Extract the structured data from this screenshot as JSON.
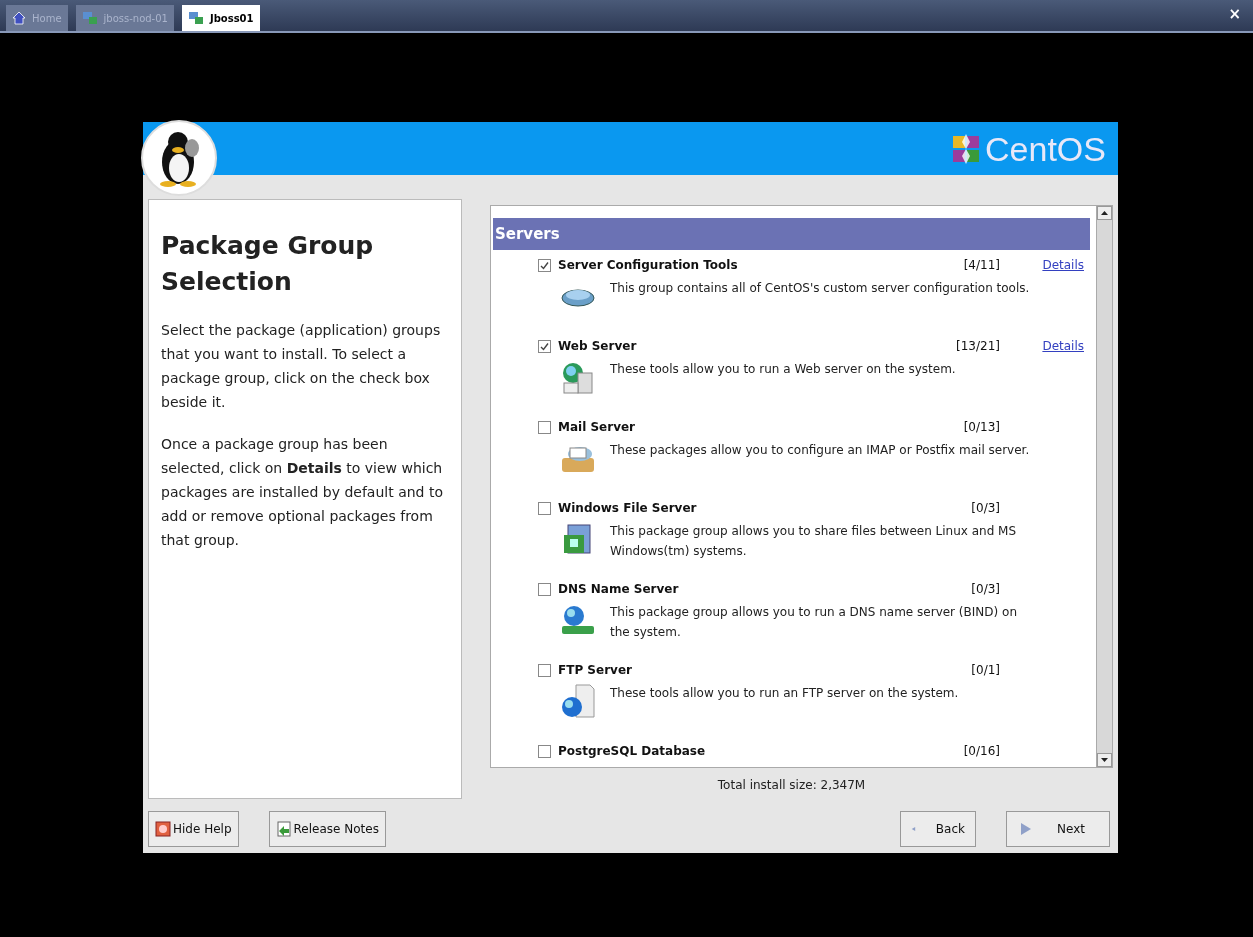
{
  "tabs": [
    {
      "label": "Home",
      "selected": false
    },
    {
      "label": "jboss-nod-01",
      "selected": false
    },
    {
      "label": "Jboss01",
      "selected": true
    }
  ],
  "close_glyph": "×",
  "header": {
    "brand": "CentOS"
  },
  "help": {
    "title": "Package Group Selection",
    "paragraphs": [
      "Select the package (application) groups that you want to install. To select a package group, click on the check box beside it.",
      "Once a package group has been selected, click on **Details** to view which packages are installed by default and to add or remove optional packages from that group."
    ]
  },
  "category": "Servers",
  "groups": [
    {
      "name": "Server Configuration Tools",
      "checked": true,
      "count": "[4/11]",
      "details": "Details",
      "description": "This group contains all of CentOS's custom server configuration tools."
    },
    {
      "name": "Web Server",
      "checked": true,
      "count": "[13/21]",
      "details": "Details",
      "description": "These tools allow you to run a Web server on the system."
    },
    {
      "name": "Mail Server",
      "checked": false,
      "count": "[0/13]",
      "description": "These packages allow you to configure an IMAP or Postfix mail server."
    },
    {
      "name": "Windows File Server",
      "checked": false,
      "count": "[0/3]",
      "description": "This package group allows you to share files between Linux and MS Windows(tm) systems."
    },
    {
      "name": "DNS Name Server",
      "checked": false,
      "count": "[0/3]",
      "description": "This package group allows you to run a DNS name server (BIND) on the system."
    },
    {
      "name": "FTP Server",
      "checked": false,
      "count": "[0/1]",
      "description": "These tools allow you to run an FTP server on the system."
    },
    {
      "name": "PostgreSQL Database",
      "checked": false,
      "count": "[0/16]"
    }
  ],
  "total_size": "Total install size: 2,347M",
  "buttons": {
    "hide_help": "Hide Help",
    "release_notes": "Release Notes",
    "back": "Back",
    "next": "Next"
  }
}
